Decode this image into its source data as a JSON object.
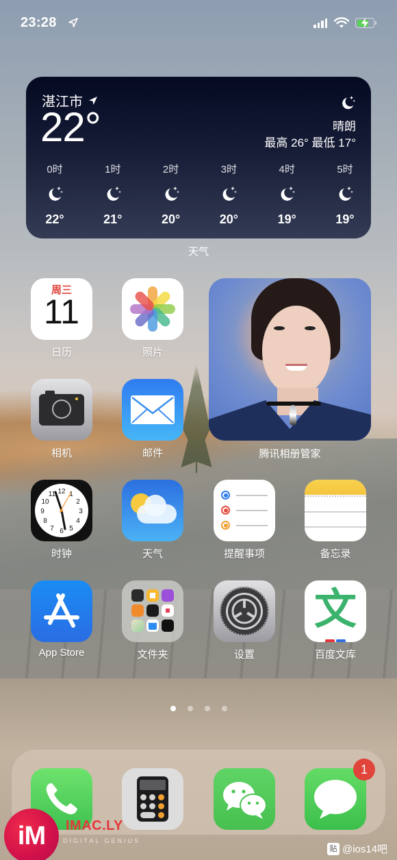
{
  "status_bar": {
    "time": "23:28",
    "location_icon": "location-arrow-icon",
    "signal_icon": "cellular-signal-icon",
    "wifi_icon": "wifi-icon",
    "battery_icon": "battery-charging-icon",
    "battery_color": "#5fd15a"
  },
  "weather_widget": {
    "city": "湛江市",
    "current_temp": "22°",
    "condition": "晴朗",
    "high_low": "最高 26° 最低 17°",
    "condition_icon": "moon-stars-icon",
    "hourly": [
      {
        "hour": "0时",
        "icon": "moon-stars-icon",
        "temp": "22°"
      },
      {
        "hour": "1时",
        "icon": "moon-stars-icon",
        "temp": "21°"
      },
      {
        "hour": "2时",
        "icon": "moon-stars-icon",
        "temp": "20°"
      },
      {
        "hour": "3时",
        "icon": "moon-stars-icon",
        "temp": "20°"
      },
      {
        "hour": "4时",
        "icon": "moon-stars-icon",
        "temp": "19°"
      },
      {
        "hour": "5时",
        "icon": "moon-stars-icon",
        "temp": "19°"
      }
    ],
    "label": "天气"
  },
  "calendar_icon": {
    "weekday": "周三",
    "day": "11",
    "weekday_color": "#e0403a"
  },
  "photo_widget": {
    "label": "腾讯相册管家"
  },
  "apps": [
    {
      "name": "日历"
    },
    {
      "name": "照片"
    },
    {
      "name": "相机"
    },
    {
      "name": "邮件"
    },
    {
      "name": "时钟"
    },
    {
      "name": "天气"
    },
    {
      "name": "提醒事项"
    },
    {
      "name": "备忘录"
    },
    {
      "name": "App Store"
    },
    {
      "name": "文件夹"
    },
    {
      "name": "设置"
    },
    {
      "name": "百度文库"
    }
  ],
  "baidu_glyph": "文",
  "page_indicator": {
    "total": 4,
    "active": 1
  },
  "dock": {
    "apps": [
      {
        "name": "phone",
        "icon": "phone-icon"
      },
      {
        "name": "calculator",
        "icon": "calculator-icon"
      },
      {
        "name": "wechat",
        "icon": "wechat-icon"
      },
      {
        "name": "messages",
        "icon": "messages-icon",
        "badge": "1"
      }
    ]
  },
  "watermarks": {
    "logo_text": "iM",
    "brand": "IMAC.LY",
    "tagline": "DIGITAL GENIUS",
    "tieba_icon": "贴",
    "tieba_handle": "@ios14吧"
  }
}
